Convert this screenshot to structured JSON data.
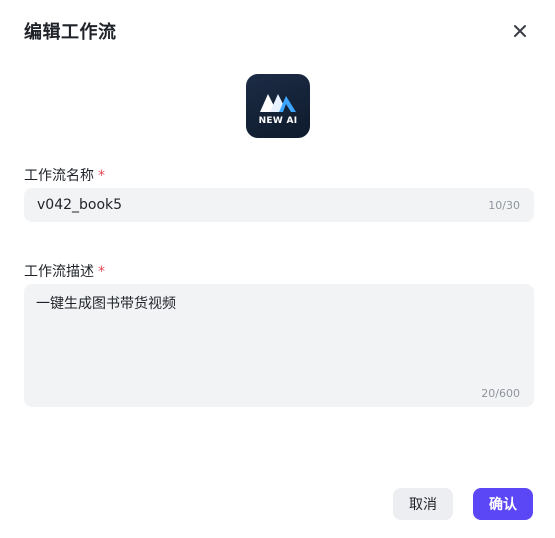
{
  "dialog": {
    "title": "编辑工作流",
    "close_icon": "close-icon"
  },
  "logo": {
    "text": "NEW AI",
    "icon": "new-ai-logo-icon"
  },
  "form": {
    "name": {
      "label": "工作流名称",
      "required_mark": "*",
      "value": "v042_book5",
      "counter": "10/30"
    },
    "description": {
      "label": "工作流描述",
      "required_mark": "*",
      "value": "一键生成图书带货视频",
      "counter": "20/600"
    }
  },
  "footer": {
    "cancel_label": "取消",
    "confirm_label": "确认"
  },
  "colors": {
    "accent": "#5b47f5",
    "required": "#e34d59",
    "field_bg": "#f2f3f5"
  }
}
